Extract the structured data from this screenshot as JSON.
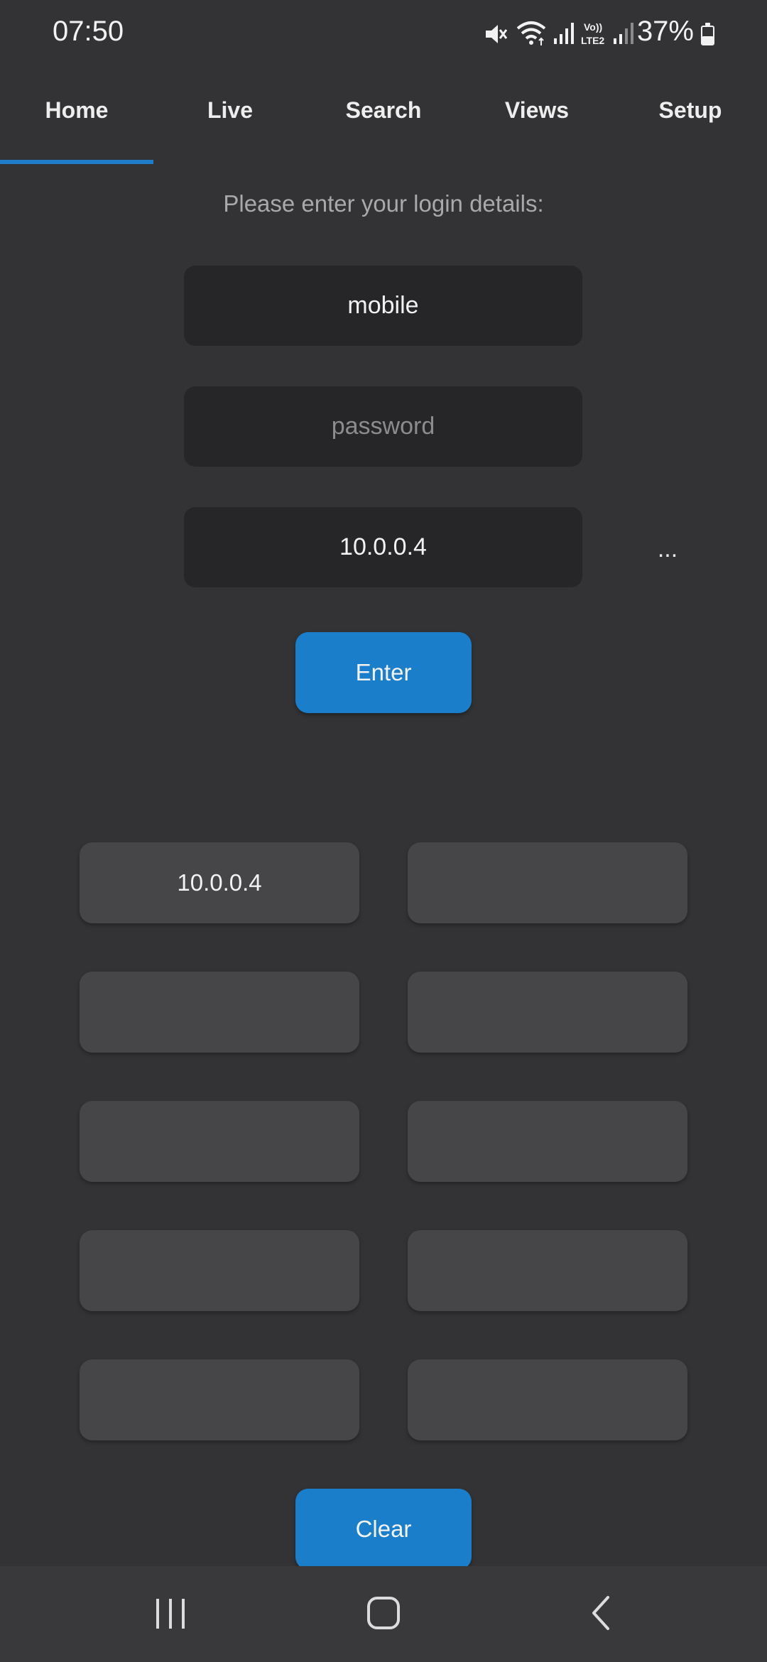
{
  "status_bar": {
    "time": "07:50",
    "battery_percent": "37%",
    "icons": [
      "mute-icon",
      "wifi-icon",
      "signal-icon",
      "volte-lte2-icon",
      "signal-icon",
      "battery-icon"
    ]
  },
  "tabs": [
    {
      "label": "Home",
      "selected": true
    },
    {
      "label": "Live",
      "selected": false
    },
    {
      "label": "Search",
      "selected": false
    },
    {
      "label": "Views",
      "selected": false
    },
    {
      "label": "Setup",
      "selected": false
    }
  ],
  "login": {
    "prompt": "Please enter your login details:",
    "username": "mobile",
    "password_placeholder": "password",
    "server": "10.0.0.4",
    "more_label": "...",
    "enter_label": "Enter"
  },
  "saved_servers": [
    "10.0.0.4",
    "",
    "",
    "",
    "",
    "",
    "",
    "",
    "",
    ""
  ],
  "clear_label": "Clear",
  "colors": {
    "background": "#333335",
    "accent": "#1a7ecb",
    "field": "#262528",
    "slot": "#464548"
  },
  "nav_bar": {
    "icons": [
      "recents-icon",
      "home-icon",
      "back-icon"
    ]
  }
}
